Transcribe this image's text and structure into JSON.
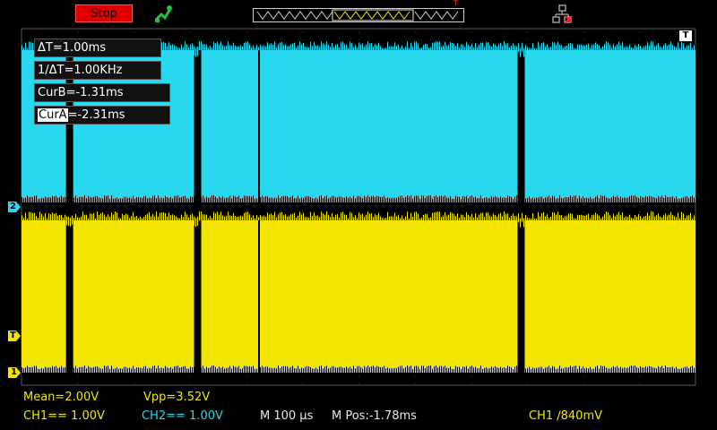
{
  "toolbar": {
    "stop_label": "Stop",
    "trigger_marker_label": "T"
  },
  "cursors": {
    "delta_t": "ΔT=1.00ms",
    "inverse_delta_t": "1/ΔT=1.00KHz",
    "cur_b": "CurB=-1.31ms",
    "cur_a_tag": "CurA",
    "cur_a_value": "=-2.31ms"
  },
  "channels": {
    "ch2_marker": "2",
    "trigger_level_marker": "T",
    "ch1_marker": "1",
    "ch1_color": "#f2e600",
    "ch2_color": "#28d8ef"
  },
  "measurements": {
    "mean": "Mean=2.00V",
    "vpp": "Vpp=3.52V"
  },
  "status": {
    "ch1_scale": "CH1== 1.00V",
    "ch2_scale": "CH2== 1.00V",
    "timebase": "M 100 µs",
    "mpos": "M Pos:-1.78ms",
    "trigger": "CH1 ∕840mV"
  },
  "waveform": {
    "ch2_gaps_ms": [
      0.35,
      1.3,
      3.7
    ],
    "ch1_gaps_ms": [
      0.35,
      1.3,
      3.7
    ]
  },
  "icons": [
    "run-icon",
    "network-icon"
  ]
}
